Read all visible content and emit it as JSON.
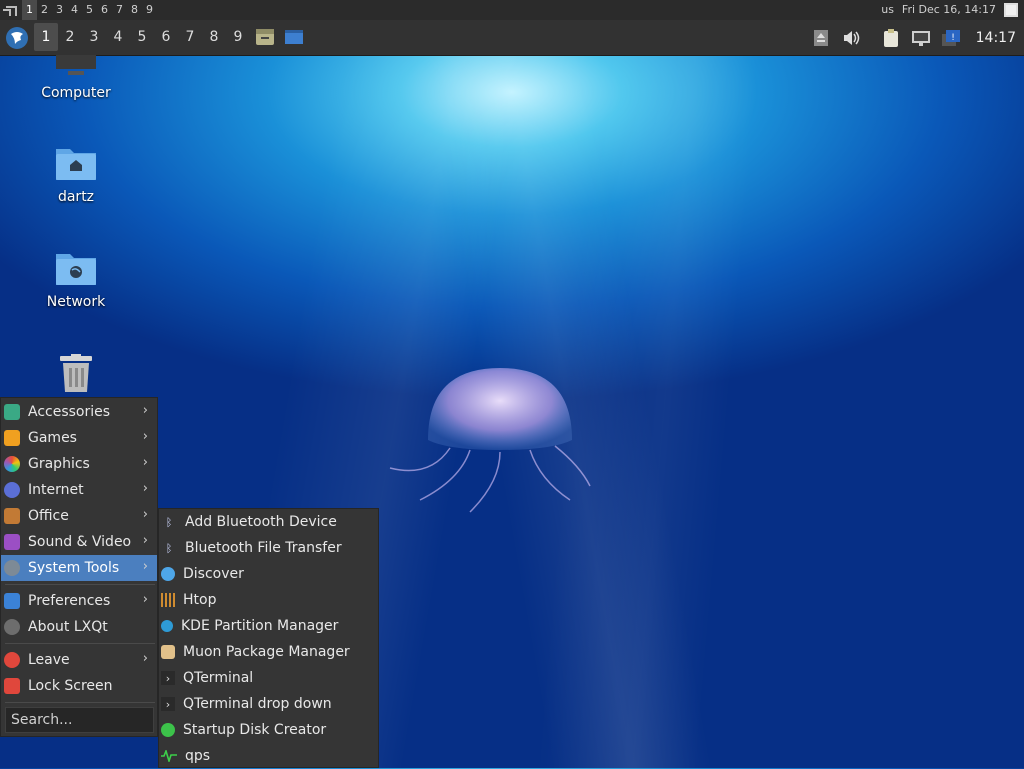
{
  "top_strip": {
    "workspaces": [
      "1",
      "2",
      "3",
      "4",
      "5",
      "6",
      "7",
      "8",
      "9"
    ],
    "current_workspace": "1",
    "keyboard_layout": "us",
    "datetime": "Fri Dec 16, 14:17"
  },
  "panel": {
    "desktops": [
      "1",
      "2",
      "3",
      "4",
      "5",
      "6",
      "7",
      "8",
      "9"
    ],
    "current_desktop": "1",
    "clock": "14:17"
  },
  "desktop_icons": [
    {
      "label": "Computer",
      "icon": "computer-icon"
    },
    {
      "label": "dartz",
      "icon": "home-folder-icon"
    },
    {
      "label": "Network",
      "icon": "network-folder-icon"
    },
    {
      "label": "",
      "icon": "trash-icon"
    }
  ],
  "start_menu": {
    "items": [
      {
        "label": "Accessories",
        "icon": "accessories-icon",
        "submenu": true
      },
      {
        "label": "Games",
        "icon": "games-icon",
        "submenu": true
      },
      {
        "label": "Graphics",
        "icon": "graphics-icon",
        "submenu": true
      },
      {
        "label": "Internet",
        "icon": "internet-icon",
        "submenu": true
      },
      {
        "label": "Office",
        "icon": "office-icon",
        "submenu": true
      },
      {
        "label": "Sound & Video",
        "icon": "sound-video-icon",
        "submenu": true
      },
      {
        "label": "System Tools",
        "icon": "system-tools-icon",
        "submenu": true,
        "active": true
      },
      {
        "label": "Preferences",
        "icon": "preferences-icon",
        "submenu": true
      },
      {
        "label": "About LXQt",
        "icon": "info-icon",
        "submenu": false
      },
      {
        "label": "Leave",
        "icon": "power-icon",
        "submenu": true
      },
      {
        "label": "Lock Screen",
        "icon": "lock-icon",
        "submenu": false
      }
    ],
    "search_placeholder": "Search..."
  },
  "system_tools_submenu": {
    "items": [
      {
        "label": "Add Bluetooth Device",
        "icon": "bluetooth-icon"
      },
      {
        "label": "Bluetooth File Transfer",
        "icon": "bluetooth-icon"
      },
      {
        "label": "Discover",
        "icon": "discover-icon"
      },
      {
        "label": "Htop",
        "icon": "htop-icon"
      },
      {
        "label": "KDE Partition Manager",
        "icon": "partition-manager-icon"
      },
      {
        "label": "Muon Package Manager",
        "icon": "package-manager-icon"
      },
      {
        "label": "QTerminal",
        "icon": "terminal-icon"
      },
      {
        "label": "QTerminal drop down",
        "icon": "terminal-icon"
      },
      {
        "label": "Startup Disk Creator",
        "icon": "startup-disk-icon"
      },
      {
        "label": "qps",
        "icon": "qps-icon"
      }
    ]
  },
  "colors": {
    "panel": "#323232",
    "menu_bg": "#353535",
    "highlight": "#4b7fbf"
  }
}
